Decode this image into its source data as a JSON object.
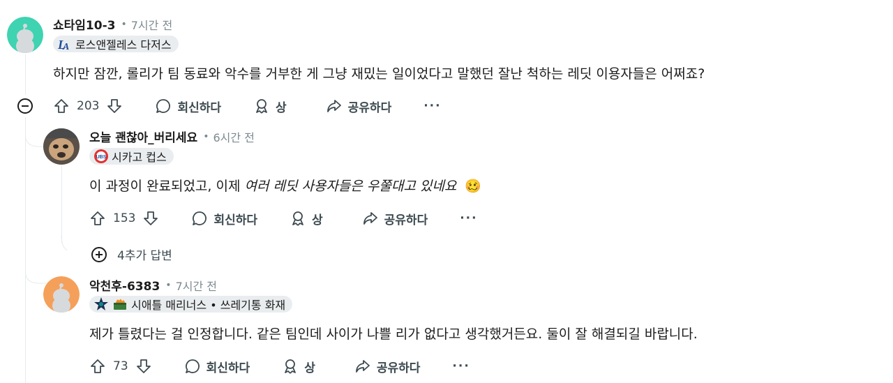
{
  "comments": [
    {
      "username": "쇼타임10-3",
      "time": "7시간 전",
      "flair": "로스앤젤레스 다저스",
      "flair_icon": "dodgers-logo-icon",
      "avatar_color": "#3fd3b2",
      "body": "하지만 잠깐, 롤리가 팀 동료와 악수를 거부한 게 그냥 재밌는 일이었다고 말했던 잘난 척하는 레딧 이용자들은 어쩌죠?",
      "score": "203",
      "reply_label": "회신하다",
      "award_label": "상",
      "share_label": "공유하다",
      "more": "···"
    },
    {
      "username": "오늘 괜찮아_버리세요",
      "time": "6시간 전",
      "flair": "시카고 컵스",
      "flair_icon": "cubs-logo-icon",
      "body_plain": "이 과정이 완료되었고, 이제 ",
      "body_italic": "여러 레딧 사용자들은 우쭐대고 있네요",
      "emoji": "🥴",
      "score": "153",
      "reply_label": "회신하다",
      "award_label": "상",
      "share_label": "공유하다",
      "more": "···",
      "more_replies": "4추가 답변"
    },
    {
      "username": "악천후-6383",
      "time": "7시간 전",
      "flair": "시애틀 매리너스 • 쓰레기통 화재",
      "flair_icon": "mariners-logo-icon",
      "flair_icon2": "dumpster-fire-icon",
      "avatar_color": "#f5a05a",
      "body": "제가 틀렸다는 걸 인정합니다. 같은 팀인데 사이가 나쁠 리가 없다고 생각했거든요. 둘이 잘 해결되길 바랍니다.",
      "score": "73",
      "reply_label": "회신하다",
      "award_label": "상",
      "share_label": "공유하다",
      "more": "···"
    }
  ],
  "colors": {
    "accent_cubs": "#e4312f",
    "dodgers_blue": "#1e4b9b",
    "mariners_navy": "#1c2e55"
  }
}
